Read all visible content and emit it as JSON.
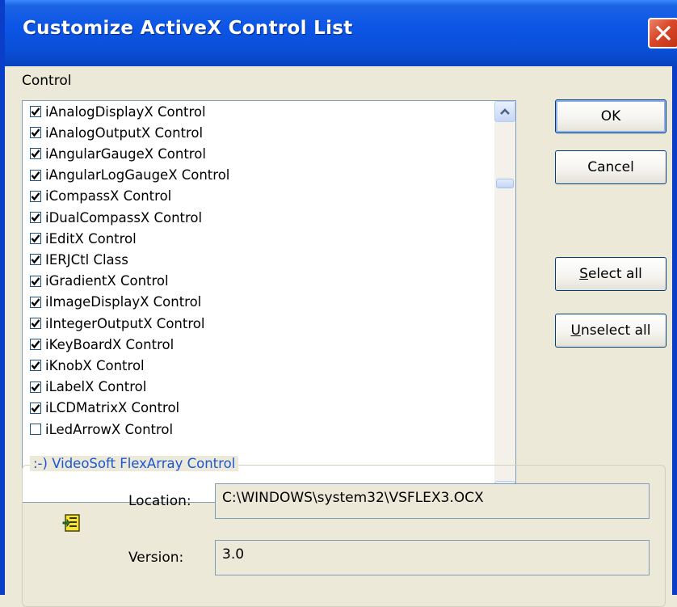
{
  "window": {
    "title": "Customize ActiveX Control List"
  },
  "control_label": "Control",
  "controls": [
    {
      "label": "iAnalogDisplayX Control",
      "checked": true
    },
    {
      "label": "iAnalogOutputX Control",
      "checked": true
    },
    {
      "label": "iAngularGaugeX Control",
      "checked": true
    },
    {
      "label": "iAngularLogGaugeX Control",
      "checked": true
    },
    {
      "label": "iCompassX Control",
      "checked": true
    },
    {
      "label": "iDualCompassX Control",
      "checked": true
    },
    {
      "label": "iEditX Control",
      "checked": true
    },
    {
      "label": "IERJCtl Class",
      "checked": true
    },
    {
      "label": "iGradientX Control",
      "checked": true
    },
    {
      "label": "iImageDisplayX Control",
      "checked": true
    },
    {
      "label": "iIntegerOutputX Control",
      "checked": true
    },
    {
      "label": "iKeyBoardX Control",
      "checked": true
    },
    {
      "label": "iKnobX Control",
      "checked": true
    },
    {
      "label": "iLabelX Control",
      "checked": true
    },
    {
      "label": "iLCDMatrixX Control",
      "checked": true
    },
    {
      "label": "iLedArrowX Control",
      "checked": false
    }
  ],
  "buttons": {
    "ok": "OK",
    "cancel": "Cancel",
    "select_all_mnemonic": "S",
    "select_all_rest": "elect all",
    "unselect_all_mnemonic": "U",
    "unselect_all_rest": "nselect all"
  },
  "details": {
    "group_title": ":-) VideoSoft FlexArray Control",
    "location_label": "Location:",
    "location_value": "C:\\WINDOWS\\system32\\VSFLEX3.OCX",
    "version_label": "Version:",
    "version_value": "3.0",
    "icon": "ocx-file-icon"
  },
  "colors": {
    "title_bar": "#0A4FD8",
    "dialog_bg": "#ECE9D8",
    "group_title": "#1A56D6",
    "close_button": "#D9482A"
  }
}
